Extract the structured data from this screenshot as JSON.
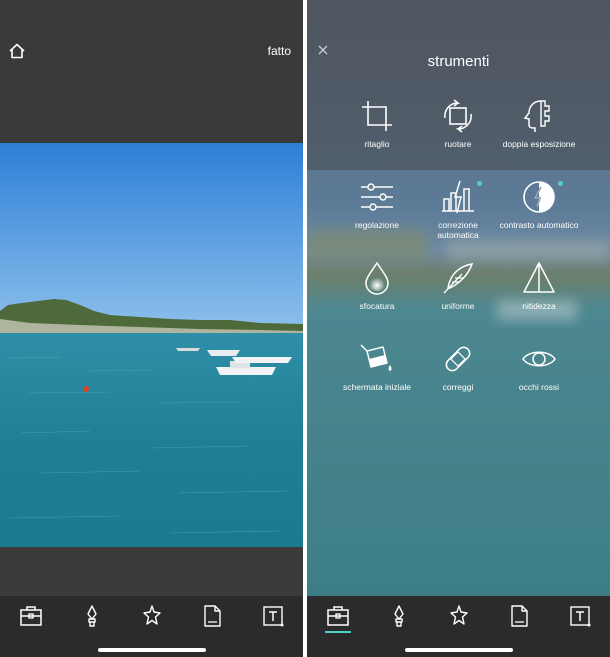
{
  "left": {
    "done_label": "fatto"
  },
  "right": {
    "title": "strumenti",
    "tools": [
      {
        "label": "ritaglio",
        "icon": "crop-icon",
        "badge": false
      },
      {
        "label": "ruotare",
        "icon": "rotate-icon",
        "badge": false
      },
      {
        "label": "doppia esposizione",
        "icon": "double-exposure-icon",
        "badge": false
      },
      {
        "label": "regolazione",
        "icon": "sliders-icon",
        "badge": false
      },
      {
        "label": "correzione automatica",
        "icon": "auto-correct-icon",
        "badge": true
      },
      {
        "label": "contrasto automatico",
        "icon": "auto-contrast-icon",
        "badge": true
      },
      {
        "label": "sfocatura",
        "icon": "blur-drop-icon",
        "badge": false
      },
      {
        "label": "uniforme",
        "icon": "feather-icon",
        "badge": false
      },
      {
        "label": "nitidezza",
        "icon": "triangle-sharpen-icon",
        "badge": false
      },
      {
        "label": "schermata iniziale",
        "icon": "paint-bucket-icon",
        "badge": false
      },
      {
        "label": "correggi",
        "icon": "bandage-icon",
        "badge": false
      },
      {
        "label": "occhi rossi",
        "icon": "eye-icon",
        "badge": false
      }
    ]
  },
  "toolbar": {
    "items": [
      "toolbox-icon",
      "brush-icon",
      "sparkle-icon",
      "document-icon",
      "text-icon"
    ]
  },
  "colors": {
    "accent": "#4fd1c5",
    "dark_bg": "#3a3a3a",
    "bar_bg": "#2b2b2b"
  }
}
